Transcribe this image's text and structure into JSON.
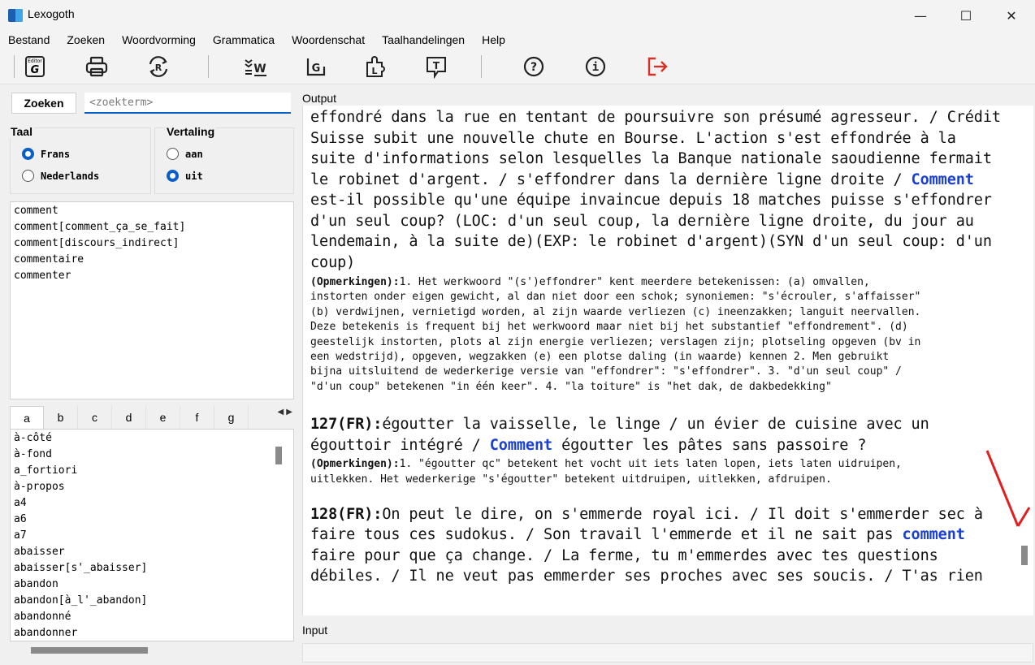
{
  "window": {
    "title": "Lexogoth",
    "minimize": "—",
    "maximize": "☐",
    "close": "✕"
  },
  "menu": [
    "Bestand",
    "Zoeken",
    "Woordvorming",
    "Grammatica",
    "Woordenschat",
    "Taalhandelingen",
    "Help"
  ],
  "toolbar": {
    "icons": [
      "editor-g-icon",
      "printer-icon",
      "refresh-r-icon",
      "sort-w-icon",
      "bracket-g-icon",
      "puzzle-l-icon",
      "speech-t-icon",
      "help-icon",
      "info-icon",
      "exit-icon"
    ],
    "editor_label": "Editor"
  },
  "search": {
    "button_label": "Zoeken",
    "placeholder": "<zoekterm>"
  },
  "taal": {
    "title": "Taal",
    "options": [
      "Frans",
      "Nederlands"
    ],
    "selected": "Frans"
  },
  "vertaling": {
    "title": "Vertaling",
    "options": [
      "aan",
      "uit"
    ],
    "selected": "uit"
  },
  "results": [
    "comment",
    "comment[comment_ça_se_fait]",
    "comment[discours_indirect]",
    "commentaire",
    "commenter"
  ],
  "alpha_tabs": [
    "a",
    "b",
    "c",
    "d",
    "e",
    "f",
    "g"
  ],
  "active_tab": "a",
  "word_list": [
    "à-côté",
    "à-fond",
    "a_fortiori",
    "à-propos",
    "a4",
    "a6",
    "a7",
    "abaisser",
    "abaisser[s'_abaisser]",
    "abandon",
    "abandon[à_l'_abandon]",
    "abandonné",
    "abandonner"
  ],
  "output": {
    "label": "Output",
    "block1": [
      "effondré dans la rue en tentant de poursuivre son présumé agresseur. / Crédit",
      "Suisse subit une nouvelle chute en Bourse. L'action s'est effondrée à la",
      "suite d'informations selon lesquelles la Banque nationale saoudienne fermait",
      "le robinet d'argent. / s'effondrer dans la dernière ligne droite / ",
      "est-il possible qu'une équipe invaincue depuis 18 matches puisse s'effondrer",
      "d'un seul coup? (LOC: d'un seul coup, la dernière ligne droite, du jour au",
      "lendemain, à la suite de)(EXP: le robinet d'argent)(SYN d'un seul coup: d'un",
      "coup)"
    ],
    "keyword": "Comment",
    "keyword_lower": "comment",
    "remarks_label": "(Opmerkingen):",
    "remarks1": [
      "1. Het werkwoord \"(s')effondrer\" kent meerdere betekenissen: (a) omvallen,",
      "instorten onder eigen gewicht, al dan niet door een schok; synoniemen: \"s'écrouler, s'affaisser\"",
      "(b) verdwijnen, vernietigd worden, al zijn waarde verliezen (c) ineenzakken; languit neervallen.",
      "Deze betekenis is frequent bij het werkwoord maar niet bij het substantief \"effondrement\". (d)",
      "geestelijk instorten, plots al zijn energie verliezen; verslagen zijn; plotseling opgeven (bv in",
      "een wedstrijd), opgeven, wegzakken (e) een plotse daling (in waarde) kennen 2. Men gebruikt",
      "bijna uitsluitend de wederkerige versie van \"effondrer\": \"s'effondrer\". 3. \"d'un seul coup\" /",
      "\"d'un coup\" betekenen \"in één keer\". 4. \"la toiture\" is \"het dak, de dakbedekking\""
    ],
    "entry127_num": "127(FR):",
    "entry127": [
      "égoutter la vaisselle, le linge / un évier de cuisine avec un",
      "égouttoir intégré / ",
      " égoutter les pâtes sans passoire ?"
    ],
    "remarks2": [
      "1. \"égoutter qc\" betekent het vocht uit iets laten lopen, iets laten uidruipen,",
      "uitlekken. Het wederkerige \"s'égoutter\" betekent uitdruipen, uitlekken, afdruipen."
    ],
    "entry128_num": "128(FR):",
    "entry128": [
      "On peut le dire, on s'emmerde royal ici. / Il doit s'emmerder sec à",
      "faire tous ces sudokus. / Son travail l'emmerde et il ne sait pas ",
      "faire pour que ça change. / La ferme, tu m'emmerdes avec tes questions",
      "débiles. / Il ne veut pas emmerder ses proches avec ses soucis. / T'as rien"
    ]
  },
  "input": {
    "label": "Input"
  },
  "colors": {
    "accent": "#0a5ec8",
    "keyword": "#1a3fd6",
    "annotation_arrow": "#e02020",
    "exit_icon": "#d93025"
  }
}
